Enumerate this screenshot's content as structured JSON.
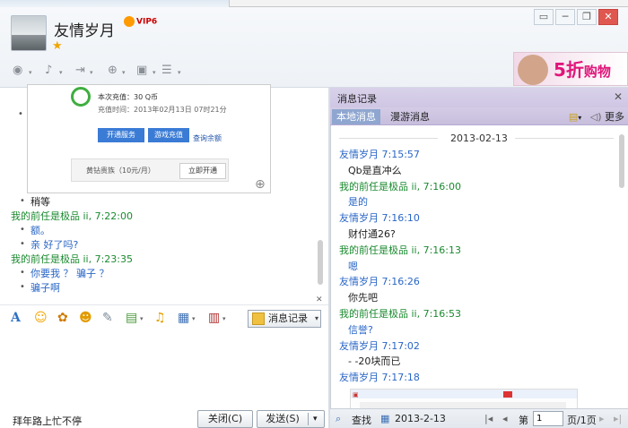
{
  "header": {
    "nickname": "友情岁月",
    "vip_badge": "VIP6",
    "star": "★",
    "icons": [
      "camera-icon",
      "microphone-icon",
      "transfer-file-icon",
      "add-contact-icon",
      "screen-share-icon",
      "app-list-icon"
    ],
    "ad": {
      "text_big": "5折",
      "text_small": "购物"
    },
    "window_buttons": [
      "▭",
      "─",
      "❐",
      "✕"
    ]
  },
  "chat": {
    "image_card": {
      "line1": "本次充值：30 Q币",
      "line2": "充值时间：2013年02月13日 07时21分",
      "btn1": "开通服务",
      "btn2": "游戏充值",
      "link": "查询余额",
      "bar_text": "黄钻贵族（10元/月）",
      "bar_btn": "立即开通"
    },
    "messages": [
      {
        "kind": "bullet",
        "color": "black",
        "text": "稍等"
      },
      {
        "kind": "sender",
        "color": "green",
        "text": "我的前任是极品 ii,  7:22:00"
      },
      {
        "kind": "bullet",
        "color": "blue",
        "text": "额。"
      },
      {
        "kind": "bullet",
        "color": "blue",
        "text": "亲  好了吗?"
      },
      {
        "kind": "sender",
        "color": "green",
        "text": "我的前任是极品 ii,  7:23:35"
      },
      {
        "kind": "bullet",
        "color": "blue",
        "text": "   你要我  ？  骗子  ？"
      },
      {
        "kind": "bullet",
        "color": "blue",
        "text": "骗子啊"
      }
    ]
  },
  "toolbar": {
    "history_button": "消息记录"
  },
  "footer": {
    "status": "拜年路上忙不停",
    "close_label": "关闭(C)",
    "send_label": "发送(S)"
  },
  "history": {
    "title": "消息记录",
    "tab_local": "本地消息",
    "tab_roam": "漫游消息",
    "more": "更多",
    "date": "2013-02-13",
    "entries": [
      {
        "color": "blue",
        "text": "友情岁月 7:15:57"
      },
      {
        "color": "black",
        "text": "Qb是直冲么",
        "indent": true
      },
      {
        "color": "green",
        "text": "我的前任是极品 ii, 7:16:00"
      },
      {
        "color": "blue",
        "text": "是的",
        "indent": true
      },
      {
        "color": "blue",
        "text": "友情岁月 7:16:10"
      },
      {
        "color": "black",
        "text": "财付通26?",
        "indent": true
      },
      {
        "color": "green",
        "text": "我的前任是极品 ii, 7:16:13"
      },
      {
        "color": "blue",
        "text": "嗯",
        "indent": true
      },
      {
        "color": "blue",
        "text": "友情岁月 7:16:26"
      },
      {
        "color": "black",
        "text": "你先吧",
        "indent": true
      },
      {
        "color": "green",
        "text": "我的前任是极品 ii, 7:16:53"
      },
      {
        "color": "blue",
        "text": "   信誉?",
        "indent": true
      },
      {
        "color": "blue",
        "text": "友情岁月 7:17:02"
      },
      {
        "color": "black",
        "text": "  - -20块而已",
        "indent": true
      },
      {
        "color": "blue",
        "text": "友情岁月 7:17:18"
      }
    ],
    "footer": {
      "find": "查找",
      "date": "2013-2-13",
      "page_prefix": "第",
      "page_value": "1",
      "page_suffix": "页/1页"
    }
  },
  "colors": {
    "green": "#1a8a2f",
    "blue": "#2966c6",
    "accent_purple": "#cfc6e4"
  }
}
